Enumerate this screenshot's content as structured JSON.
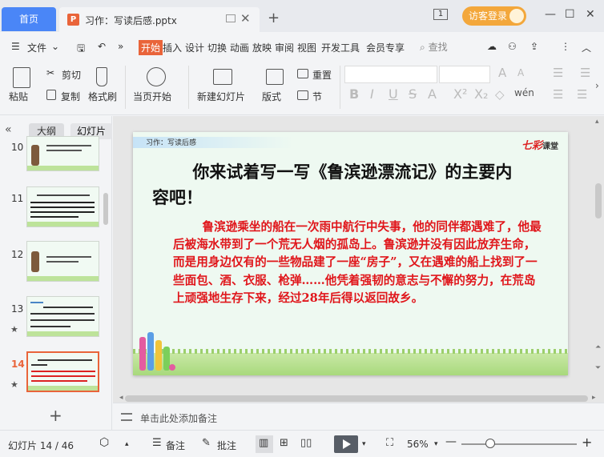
{
  "titlebar": {
    "home_tab": "首页",
    "doc_tab_title": "习作：写读后感.pptx",
    "window_count": "1",
    "login_label": "访客登录"
  },
  "menubar": {
    "file": "文件",
    "items": [
      "开始",
      "插入",
      "设计",
      "切换",
      "动画",
      "放映",
      "审阅",
      "视图",
      "开发工具",
      "会员专享"
    ],
    "active": "开始",
    "search_placeholder": "查找"
  },
  "ribbon": {
    "paste": "粘贴",
    "cut": "剪切",
    "copy": "复制",
    "format_painter": "格式刷",
    "play_from_current": "当页开始",
    "new_slide": "新建幻灯片",
    "layout": "版式",
    "reset": "重置",
    "section": "节"
  },
  "leftpane": {
    "outline_tab": "大纲",
    "slides_tab": "幻灯片",
    "slides": [
      {
        "number": "10",
        "starred": false
      },
      {
        "number": "11",
        "starred": false
      },
      {
        "number": "12",
        "starred": false
      },
      {
        "number": "13",
        "starred": true
      },
      {
        "number": "14",
        "starred": true,
        "current": true
      }
    ]
  },
  "slide": {
    "header": "习作：写读后感",
    "logo_main": "七彩",
    "logo_sub": "课堂",
    "title": "你来试着写一写《鲁滨逊漂流记》的主要内容吧！",
    "body": "鲁滨逊乘坐的船在一次雨中航行中失事，他的同伴都遇难了，他最后被海水带到了一个荒无人烟的孤岛上。鲁滨逊并没有因此放弃生命，而是用身边仅有的一些物品建了一座“房子”，又在遇难的船上找到了一些面包、酒、衣服、枪弹……他凭着强韧的意志与不懈的努力，在荒岛上顽强地生存下来，经过28年后得以返回故乡。"
  },
  "notes": {
    "placeholder": "单击此处添加备注"
  },
  "statusbar": {
    "slide_counter": "幻灯片 14 / 46",
    "notes_label": "备注",
    "comments_label": "批注",
    "zoom": "56%",
    "zoom_level": 0.56
  },
  "colors": {
    "accent": "#e9643a",
    "home_tab": "#4a86f7",
    "slide_text": "#e0161b"
  }
}
